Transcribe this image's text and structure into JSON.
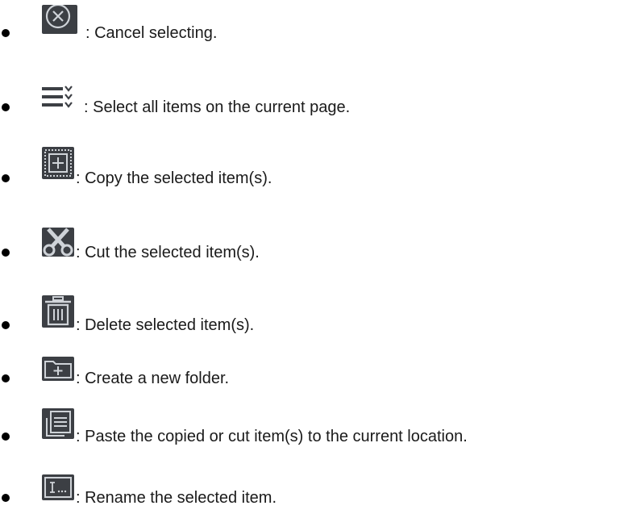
{
  "items": [
    {
      "icon": "cancel-circle-icon",
      "text": ": Cancel selecting."
    },
    {
      "icon": "select-all-list-icon",
      "text": ": Select all items on the current page."
    },
    {
      "icon": "copy-icon",
      "text": ": Copy the selected item(s)."
    },
    {
      "icon": "scissors-icon",
      "text": ": Cut the selected item(s)."
    },
    {
      "icon": "trash-icon",
      "text": ": Delete selected item(s)."
    },
    {
      "icon": "new-folder-icon",
      "text": ": Create a new folder."
    },
    {
      "icon": "paste-icon",
      "text": ": Paste the copied or cut item(s) to the current location."
    },
    {
      "icon": "rename-icon",
      "text": ": Rename the selected item."
    }
  ],
  "colors": {
    "icon_background": "#3c3f44",
    "icon_stroke": "#cfd3d8",
    "bullet": "#000000",
    "text": "#1a1a1a"
  }
}
